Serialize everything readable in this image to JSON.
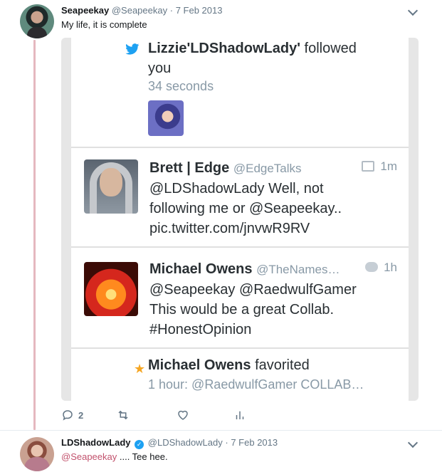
{
  "tweet1": {
    "name": "Seapeekay",
    "handle": "@Seapeekay",
    "separator": "·",
    "date": "7 Feb 2013",
    "text": "My life, it is complete",
    "reply_count": "2"
  },
  "screenshot": {
    "row1": {
      "name": "Lizzie'LDShadowLady'",
      "action": "followed",
      "action2": "you",
      "time": "34 seconds"
    },
    "row2": {
      "name": "Brett | Edge",
      "handle": "@EdgeTalks",
      "time": "1m",
      "line1": "@LDShadowLady Well, not",
      "line2": "following me or @Seapeekay..",
      "line3": "pic.twitter.com/jnvwR9RV"
    },
    "row3": {
      "name": "Michael Owens",
      "handle": "@TheNames…",
      "time": "1h",
      "line1": "@Seapeekay @RaedwulfGamer",
      "line2": "This would be a great Collab.",
      "line3": "#HonestOpinion"
    },
    "row4": {
      "name": "Michael Owens",
      "action": "favorited",
      "detail": "1 hour: @RaedwulfGamer COLLAB…"
    }
  },
  "tweet2": {
    "name": "LDShadowLady",
    "verified_mark": "✓",
    "handle": "@LDShadowLady",
    "separator": "·",
    "date": "7 Feb 2013",
    "mention": "@Seapeekay",
    "text": " .... Tee hee."
  },
  "icons": [
    "twitter-bird-icon",
    "reply-icon",
    "retweet-icon",
    "like-icon",
    "analytics-icon",
    "chevron-down-icon",
    "star-icon",
    "verified-icon"
  ],
  "colors": {
    "accent_thread": "#e5b8bf",
    "mention": "#c2526d",
    "twitter_blue": "#1da1f2",
    "star": "#f5a623"
  }
}
